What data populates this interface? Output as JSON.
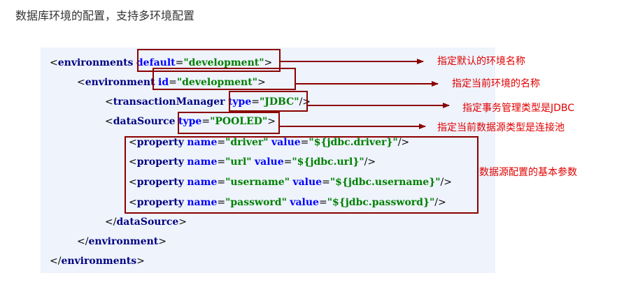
{
  "heading": "数据库环境的配置，支持多环境配置",
  "colors": {
    "code_background": "#eef3fc",
    "tag_color": "#000080",
    "attribute_color": "#0000ff",
    "value_color": "#008000",
    "highlight_box_color": "#8b0000",
    "annotation_color": "#e00000"
  },
  "code": {
    "environments_open": {
      "open": "<",
      "tag": "environments",
      "attr": "default",
      "eq": "=",
      "value": "\"development\"",
      "close": ">"
    },
    "environment_open": {
      "open": "<",
      "tag": "environment",
      "attr": "id",
      "eq": "=",
      "value": "\"development\"",
      "close": ">"
    },
    "transaction_manager": {
      "open": "<",
      "tag": "transactionManager",
      "attr": "type",
      "eq": "=",
      "value": "\"JDBC\"",
      "close": "/>"
    },
    "datasource_open": {
      "open": "<",
      "tag": "dataSource",
      "attr": "type",
      "eq": "=",
      "value": "\"POOLED\"",
      "close": ">"
    },
    "properties": [
      {
        "open": "<",
        "tag": "property",
        "name_attr": "name",
        "name_value": "\"driver\"",
        "value_attr": "value",
        "value_value": "\"${jdbc.driver}\"",
        "eq": "=",
        "close": "/>"
      },
      {
        "open": "<",
        "tag": "property",
        "name_attr": "name",
        "name_value": "\"url\"",
        "value_attr": "value",
        "value_value": "\"${jdbc.url}\"",
        "eq": "=",
        "close": "/>"
      },
      {
        "open": "<",
        "tag": "property",
        "name_attr": "name",
        "name_value": "\"username\"",
        "value_attr": "value",
        "value_value": "\"${jdbc.username}\"",
        "eq": "=",
        "close": "/>"
      },
      {
        "open": "<",
        "tag": "property",
        "name_attr": "name",
        "name_value": "\"password\"",
        "value_attr": "value",
        "value_value": "\"${jdbc.password}\"",
        "eq": "=",
        "close": "/>"
      }
    ],
    "datasource_close": {
      "open": "</",
      "tag": "dataSource",
      "close": ">"
    },
    "environment_close": {
      "open": "</",
      "tag": "environment",
      "close": ">"
    },
    "environments_close": {
      "open": "</",
      "tag": "environments",
      "close": ">"
    }
  },
  "annotations": {
    "default_env": "指定默认的环境名称",
    "current_env": "指定当前环境的名称",
    "transaction_type": "指定事务管理类型是JDBC",
    "datasource_type": "指定当前数据源类型是连接池",
    "datasource_params": "数据源配置的基本参数"
  }
}
